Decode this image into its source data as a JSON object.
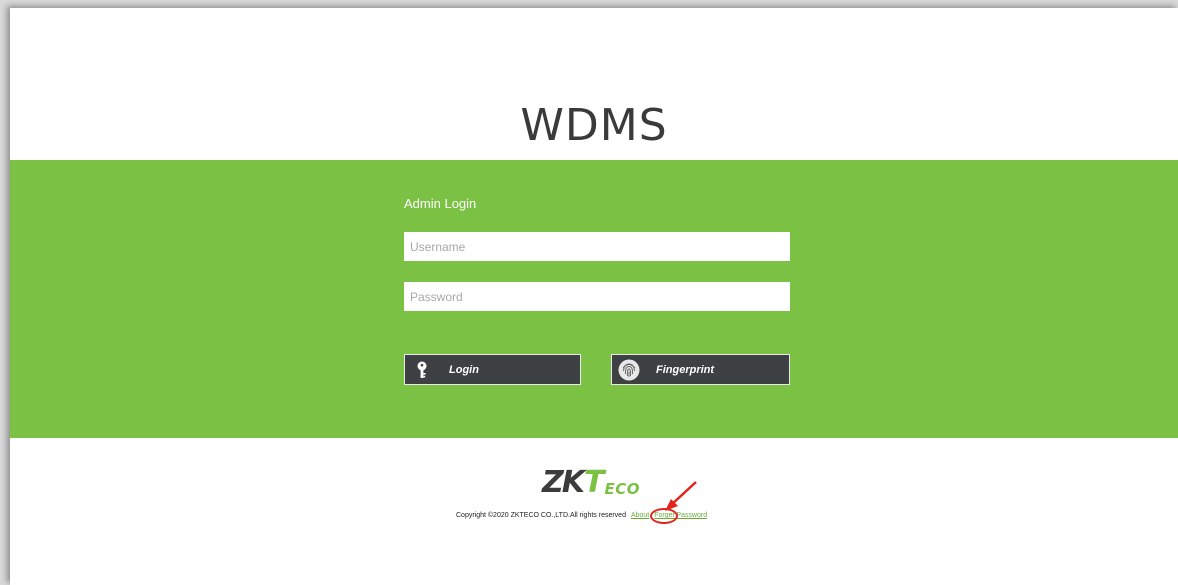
{
  "header": {
    "app_title": "WDMS"
  },
  "login_form": {
    "title": "Admin Login",
    "username_placeholder": "Username",
    "password_placeholder": "Password",
    "login_label": "Login",
    "fingerprint_label": "Fingerprint",
    "icons": {
      "login": "key-icon",
      "fingerprint": "fingerprint-icon"
    }
  },
  "footer": {
    "logo_text": "ZKTeco",
    "logo_parts": {
      "zk": "ZK",
      "t": "T",
      "eco": "ECO"
    },
    "copyright": "Copyright ©2020 ZKTECO CO.,LTD.All rights reserved",
    "about_link": "About",
    "forget_password_link": "Forget Password"
  },
  "colors": {
    "band_green": "#7bc143",
    "button_dark": "#3e4144",
    "annotation_red": "#e3241d"
  }
}
